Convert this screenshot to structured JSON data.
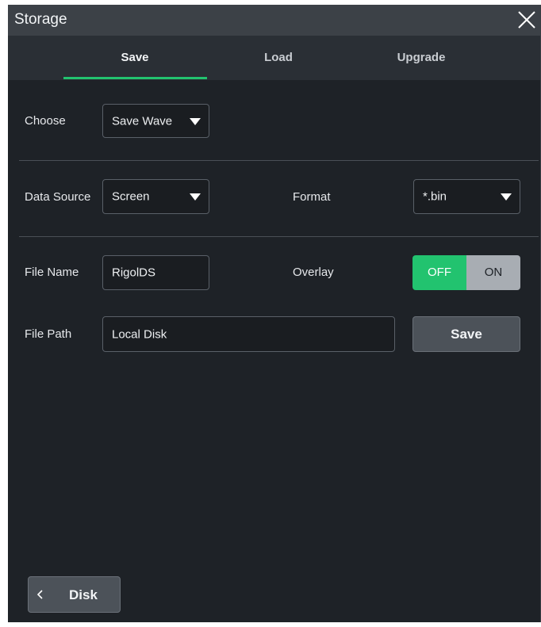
{
  "dialog": {
    "title": "Storage",
    "close_icon": "close-icon"
  },
  "tabs": [
    {
      "label": "Save",
      "active": true
    },
    {
      "label": "Load",
      "active": false
    },
    {
      "label": "Upgrade",
      "active": false
    }
  ],
  "choose": {
    "label": "Choose",
    "value": "Save Wave"
  },
  "data_source": {
    "label": "Data Source",
    "value": "Screen"
  },
  "format": {
    "label": "Format",
    "value": "*.bin"
  },
  "file_name": {
    "label": "File Name",
    "value": "RigolDS"
  },
  "overlay": {
    "label": "Overlay",
    "off_label": "OFF",
    "on_label": "ON",
    "state": "OFF"
  },
  "file_path": {
    "label": "File Path",
    "value": "Local Disk"
  },
  "save_button": "Save",
  "back_button": "Disk",
  "colors": {
    "accent": "#22c36f",
    "background": "#1e2227",
    "titlebar": "#3c4147"
  }
}
